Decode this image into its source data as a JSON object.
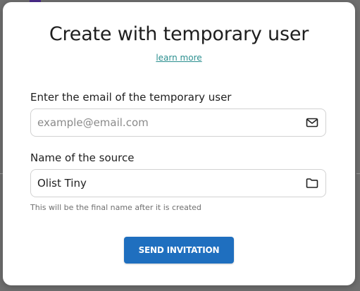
{
  "modal": {
    "title": "Create with temporary user",
    "learn_more": "learn more",
    "email": {
      "label": "Enter the email of the temporary user",
      "placeholder": "example@email.com",
      "value": "",
      "icon": "mail-icon"
    },
    "source": {
      "label": "Name of the source",
      "value": "Olist Tiny",
      "icon": "folder-icon",
      "hint": "This will be the final name after it is created"
    },
    "send_button": "SEND INVITATION"
  },
  "colors": {
    "accent": "#1f6fbf",
    "link": "#2b8f8f",
    "overlay": "#6f6f6f"
  }
}
